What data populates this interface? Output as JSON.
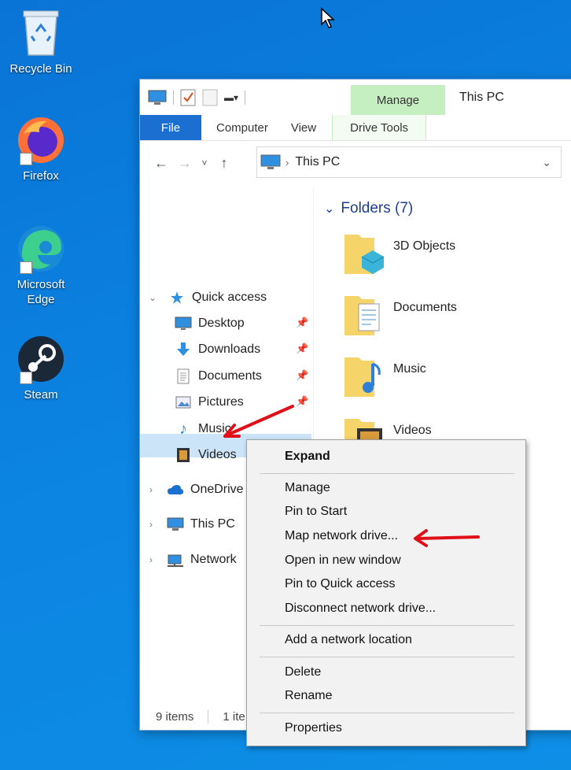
{
  "desktop": {
    "icons": [
      {
        "label": "Recycle Bin"
      },
      {
        "label": "Firefox"
      },
      {
        "label": "Microsoft Edge"
      },
      {
        "label": "Steam"
      }
    ]
  },
  "window": {
    "title": "This PC",
    "manage_tab": "Manage",
    "ribbon_tabs": [
      "File",
      "Computer",
      "View",
      "Drive Tools"
    ],
    "address_path": "This PC"
  },
  "nav_tree": {
    "quick_access": "Quick access",
    "quick_items": [
      "Desktop",
      "Downloads",
      "Documents",
      "Pictures",
      "Music",
      "Videos"
    ],
    "onedrive": "OneDrive",
    "this_pc": "This PC",
    "network": "Network"
  },
  "content": {
    "group_header": "Folders (7)",
    "folders": [
      "3D Objects",
      "Documents",
      "Music",
      "Videos"
    ]
  },
  "status_bar": {
    "items_count": "9 items",
    "selected": "1 ite"
  },
  "context_menu": {
    "items": [
      "Expand",
      "Manage",
      "Pin to Start",
      "Map network drive...",
      "Open in new window",
      "Pin to Quick access",
      "Disconnect network drive...",
      "Add a network location",
      "Delete",
      "Rename",
      "Properties"
    ]
  },
  "colors": {
    "desktop": "#0b82e0",
    "file_tab": "#1a6fd0",
    "manage_tab": "#c6efc1",
    "selection": "#cce4f7",
    "annotation_arrow": "#e0101a"
  }
}
